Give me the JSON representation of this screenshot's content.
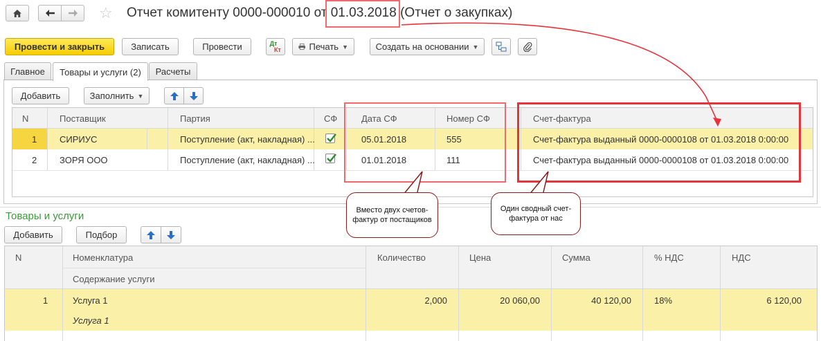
{
  "window": {
    "title_prefix": "Отчет комитенту 0000-000010 от ",
    "title_date": "01.03.2018",
    "title_suffix": " (Отчет о закупках)",
    "home_icon": "home-icon",
    "back_icon": "arrow-left-icon",
    "forward_icon": "arrow-right-icon",
    "star_icon": "star-icon"
  },
  "toolbar": {
    "post_close": "Провести и закрыть",
    "save": "Записать",
    "post": "Провести",
    "dtkt_top": "Дт",
    "dtkt_bottom": "Кт",
    "print": "Печать",
    "create_based": "Создать на основании"
  },
  "tabs": [
    "Главное",
    "Товары и услуги (2)",
    "Расчеты"
  ],
  "suppliers_toolbar": {
    "add": "Добавить",
    "fill": "Заполнить"
  },
  "suppliers_table": {
    "headers": {
      "n": "N",
      "supplier": "Поставщик",
      "batch": "Партия",
      "sf": "СФ",
      "sf_date": "Дата СФ",
      "sf_number": "Номер СФ",
      "invoice": "Счет-фактура"
    },
    "rows": [
      {
        "n": "1",
        "supplier": "СИРИУС",
        "batch": "Поступление (акт, накладная) ...",
        "sf_checked": true,
        "sf_date": "05.01.2018",
        "sf_number": "555",
        "invoice": "Счет-фактура выданный 0000-0000108 от 01.03.2018 0:00:00"
      },
      {
        "n": "2",
        "supplier": "ЗОРЯ ООО",
        "batch": "Поступление (акт, накладная) ...",
        "sf_checked": true,
        "sf_date": "01.01.2018",
        "sf_number": "111",
        "invoice": "Счет-фактура выданный 0000-0000108 от 01.03.2018 0:00:00"
      }
    ]
  },
  "annotations": {
    "left_bubble": "Вместо двух счетов-фактур от постащиков",
    "right_bubble": "Один сводный счет-фактура от нас"
  },
  "goods_section": {
    "title": "Товары и услуги",
    "add": "Добавить",
    "select": "Подбор",
    "headers": {
      "n": "N",
      "nomenclature": "Номенклатура",
      "service_content": "Содержание услуги",
      "quantity": "Количество",
      "price": "Цена",
      "sum": "Сумма",
      "vat_rate": "% НДС",
      "vat": "НДС"
    },
    "rows": [
      {
        "n": "1",
        "nomenclature": "Услуга 1",
        "service_content": "Услуга 1",
        "quantity": "2,000",
        "price": "20 060,00",
        "sum": "40 120,00",
        "vat_rate": "18%",
        "vat": "6 120,00"
      }
    ]
  },
  "colors": {
    "accent_yellow": "#f5cd00",
    "selection": "#fbf0a8",
    "annotation_red": "#e8333a",
    "section_green": "#3a9a3a",
    "check_green": "#2e8b2e"
  }
}
